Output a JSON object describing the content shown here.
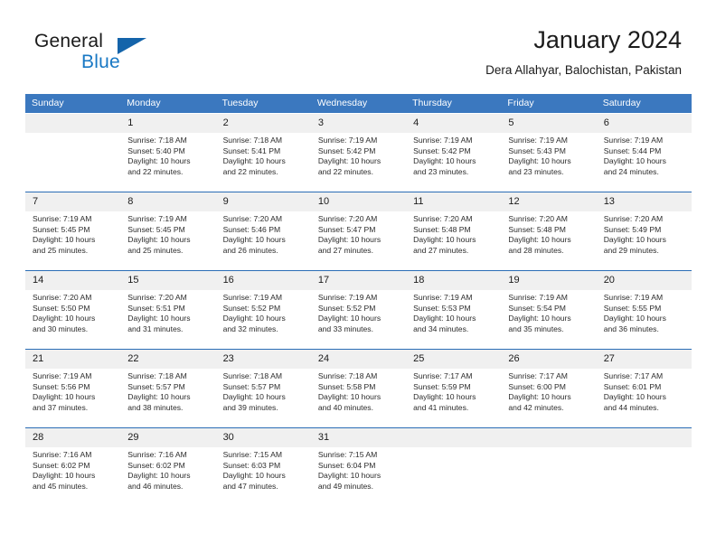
{
  "brand": {
    "name_part1": "General",
    "name_part2": "Blue"
  },
  "header": {
    "month_title": "January 2024",
    "location": "Dera Allahyar, Balochistan, Pakistan"
  },
  "colors": {
    "header_bar": "#3b78bf",
    "separator": "#2a6db5",
    "date_band": "#f0f0f0",
    "brand_blue": "#1878c4"
  },
  "weekday_headers": [
    "Sunday",
    "Monday",
    "Tuesday",
    "Wednesday",
    "Thursday",
    "Friday",
    "Saturday"
  ],
  "weeks": [
    [
      {
        "day": "",
        "sunrise": "",
        "sunset": "",
        "daylight1": "",
        "daylight2": ""
      },
      {
        "day": "1",
        "sunrise": "Sunrise: 7:18 AM",
        "sunset": "Sunset: 5:40 PM",
        "daylight1": "Daylight: 10 hours",
        "daylight2": "and 22 minutes."
      },
      {
        "day": "2",
        "sunrise": "Sunrise: 7:18 AM",
        "sunset": "Sunset: 5:41 PM",
        "daylight1": "Daylight: 10 hours",
        "daylight2": "and 22 minutes."
      },
      {
        "day": "3",
        "sunrise": "Sunrise: 7:19 AM",
        "sunset": "Sunset: 5:42 PM",
        "daylight1": "Daylight: 10 hours",
        "daylight2": "and 22 minutes."
      },
      {
        "day": "4",
        "sunrise": "Sunrise: 7:19 AM",
        "sunset": "Sunset: 5:42 PM",
        "daylight1": "Daylight: 10 hours",
        "daylight2": "and 23 minutes."
      },
      {
        "day": "5",
        "sunrise": "Sunrise: 7:19 AM",
        "sunset": "Sunset: 5:43 PM",
        "daylight1": "Daylight: 10 hours",
        "daylight2": "and 23 minutes."
      },
      {
        "day": "6",
        "sunrise": "Sunrise: 7:19 AM",
        "sunset": "Sunset: 5:44 PM",
        "daylight1": "Daylight: 10 hours",
        "daylight2": "and 24 minutes."
      }
    ],
    [
      {
        "day": "7",
        "sunrise": "Sunrise: 7:19 AM",
        "sunset": "Sunset: 5:45 PM",
        "daylight1": "Daylight: 10 hours",
        "daylight2": "and 25 minutes."
      },
      {
        "day": "8",
        "sunrise": "Sunrise: 7:19 AM",
        "sunset": "Sunset: 5:45 PM",
        "daylight1": "Daylight: 10 hours",
        "daylight2": "and 25 minutes."
      },
      {
        "day": "9",
        "sunrise": "Sunrise: 7:20 AM",
        "sunset": "Sunset: 5:46 PM",
        "daylight1": "Daylight: 10 hours",
        "daylight2": "and 26 minutes."
      },
      {
        "day": "10",
        "sunrise": "Sunrise: 7:20 AM",
        "sunset": "Sunset: 5:47 PM",
        "daylight1": "Daylight: 10 hours",
        "daylight2": "and 27 minutes."
      },
      {
        "day": "11",
        "sunrise": "Sunrise: 7:20 AM",
        "sunset": "Sunset: 5:48 PM",
        "daylight1": "Daylight: 10 hours",
        "daylight2": "and 27 minutes."
      },
      {
        "day": "12",
        "sunrise": "Sunrise: 7:20 AM",
        "sunset": "Sunset: 5:48 PM",
        "daylight1": "Daylight: 10 hours",
        "daylight2": "and 28 minutes."
      },
      {
        "day": "13",
        "sunrise": "Sunrise: 7:20 AM",
        "sunset": "Sunset: 5:49 PM",
        "daylight1": "Daylight: 10 hours",
        "daylight2": "and 29 minutes."
      }
    ],
    [
      {
        "day": "14",
        "sunrise": "Sunrise: 7:20 AM",
        "sunset": "Sunset: 5:50 PM",
        "daylight1": "Daylight: 10 hours",
        "daylight2": "and 30 minutes."
      },
      {
        "day": "15",
        "sunrise": "Sunrise: 7:20 AM",
        "sunset": "Sunset: 5:51 PM",
        "daylight1": "Daylight: 10 hours",
        "daylight2": "and 31 minutes."
      },
      {
        "day": "16",
        "sunrise": "Sunrise: 7:19 AM",
        "sunset": "Sunset: 5:52 PM",
        "daylight1": "Daylight: 10 hours",
        "daylight2": "and 32 minutes."
      },
      {
        "day": "17",
        "sunrise": "Sunrise: 7:19 AM",
        "sunset": "Sunset: 5:52 PM",
        "daylight1": "Daylight: 10 hours",
        "daylight2": "and 33 minutes."
      },
      {
        "day": "18",
        "sunrise": "Sunrise: 7:19 AM",
        "sunset": "Sunset: 5:53 PM",
        "daylight1": "Daylight: 10 hours",
        "daylight2": "and 34 minutes."
      },
      {
        "day": "19",
        "sunrise": "Sunrise: 7:19 AM",
        "sunset": "Sunset: 5:54 PM",
        "daylight1": "Daylight: 10 hours",
        "daylight2": "and 35 minutes."
      },
      {
        "day": "20",
        "sunrise": "Sunrise: 7:19 AM",
        "sunset": "Sunset: 5:55 PM",
        "daylight1": "Daylight: 10 hours",
        "daylight2": "and 36 minutes."
      }
    ],
    [
      {
        "day": "21",
        "sunrise": "Sunrise: 7:19 AM",
        "sunset": "Sunset: 5:56 PM",
        "daylight1": "Daylight: 10 hours",
        "daylight2": "and 37 minutes."
      },
      {
        "day": "22",
        "sunrise": "Sunrise: 7:18 AM",
        "sunset": "Sunset: 5:57 PM",
        "daylight1": "Daylight: 10 hours",
        "daylight2": "and 38 minutes."
      },
      {
        "day": "23",
        "sunrise": "Sunrise: 7:18 AM",
        "sunset": "Sunset: 5:57 PM",
        "daylight1": "Daylight: 10 hours",
        "daylight2": "and 39 minutes."
      },
      {
        "day": "24",
        "sunrise": "Sunrise: 7:18 AM",
        "sunset": "Sunset: 5:58 PM",
        "daylight1": "Daylight: 10 hours",
        "daylight2": "and 40 minutes."
      },
      {
        "day": "25",
        "sunrise": "Sunrise: 7:17 AM",
        "sunset": "Sunset: 5:59 PM",
        "daylight1": "Daylight: 10 hours",
        "daylight2": "and 41 minutes."
      },
      {
        "day": "26",
        "sunrise": "Sunrise: 7:17 AM",
        "sunset": "Sunset: 6:00 PM",
        "daylight1": "Daylight: 10 hours",
        "daylight2": "and 42 minutes."
      },
      {
        "day": "27",
        "sunrise": "Sunrise: 7:17 AM",
        "sunset": "Sunset: 6:01 PM",
        "daylight1": "Daylight: 10 hours",
        "daylight2": "and 44 minutes."
      }
    ],
    [
      {
        "day": "28",
        "sunrise": "Sunrise: 7:16 AM",
        "sunset": "Sunset: 6:02 PM",
        "daylight1": "Daylight: 10 hours",
        "daylight2": "and 45 minutes."
      },
      {
        "day": "29",
        "sunrise": "Sunrise: 7:16 AM",
        "sunset": "Sunset: 6:02 PM",
        "daylight1": "Daylight: 10 hours",
        "daylight2": "and 46 minutes."
      },
      {
        "day": "30",
        "sunrise": "Sunrise: 7:15 AM",
        "sunset": "Sunset: 6:03 PM",
        "daylight1": "Daylight: 10 hours",
        "daylight2": "and 47 minutes."
      },
      {
        "day": "31",
        "sunrise": "Sunrise: 7:15 AM",
        "sunset": "Sunset: 6:04 PM",
        "daylight1": "Daylight: 10 hours",
        "daylight2": "and 49 minutes."
      },
      {
        "day": "",
        "sunrise": "",
        "sunset": "",
        "daylight1": "",
        "daylight2": ""
      },
      {
        "day": "",
        "sunrise": "",
        "sunset": "",
        "daylight1": "",
        "daylight2": ""
      },
      {
        "day": "",
        "sunrise": "",
        "sunset": "",
        "daylight1": "",
        "daylight2": ""
      }
    ]
  ]
}
